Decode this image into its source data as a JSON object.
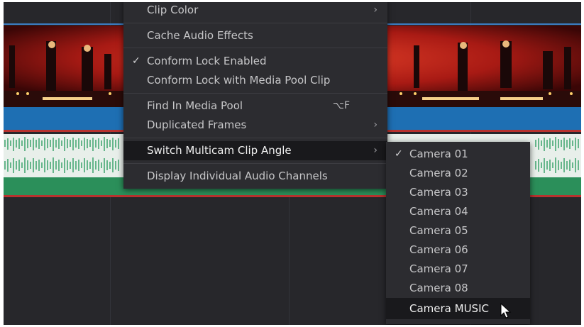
{
  "context_menu": {
    "items": [
      {
        "label": "Clip Color",
        "has_submenu": true
      },
      {
        "label": "Cache Audio Effects"
      },
      {
        "label": "Conform Lock Enabled",
        "checked": true
      },
      {
        "label": "Conform Lock with Media Pool Clip"
      },
      {
        "label": "Find In Media Pool",
        "shortcut": "⌥F"
      },
      {
        "label": "Duplicated Frames",
        "has_submenu": true
      },
      {
        "label": "Switch Multicam Clip Angle",
        "has_submenu": true,
        "highlighted": true
      },
      {
        "label": "Display Individual Audio Channels"
      }
    ]
  },
  "submenu": {
    "items": [
      {
        "label": "Camera 01",
        "checked": true
      },
      {
        "label": "Camera 02"
      },
      {
        "label": "Camera 03"
      },
      {
        "label": "Camera 04"
      },
      {
        "label": "Camera 05"
      },
      {
        "label": "Camera 06"
      },
      {
        "label": "Camera 07"
      },
      {
        "label": "Camera 08"
      },
      {
        "label": "Camera MUSIC",
        "highlighted": true
      }
    ]
  },
  "icons": {
    "check": "✓",
    "chevron": "›"
  },
  "colors": {
    "background": "#27272b",
    "menu_bg": "#2c2c30",
    "highlight": "#19191c",
    "clip_blue": "#1e6fb3",
    "audio_green": "#2b8f5a",
    "track_red": "#b8322f"
  }
}
